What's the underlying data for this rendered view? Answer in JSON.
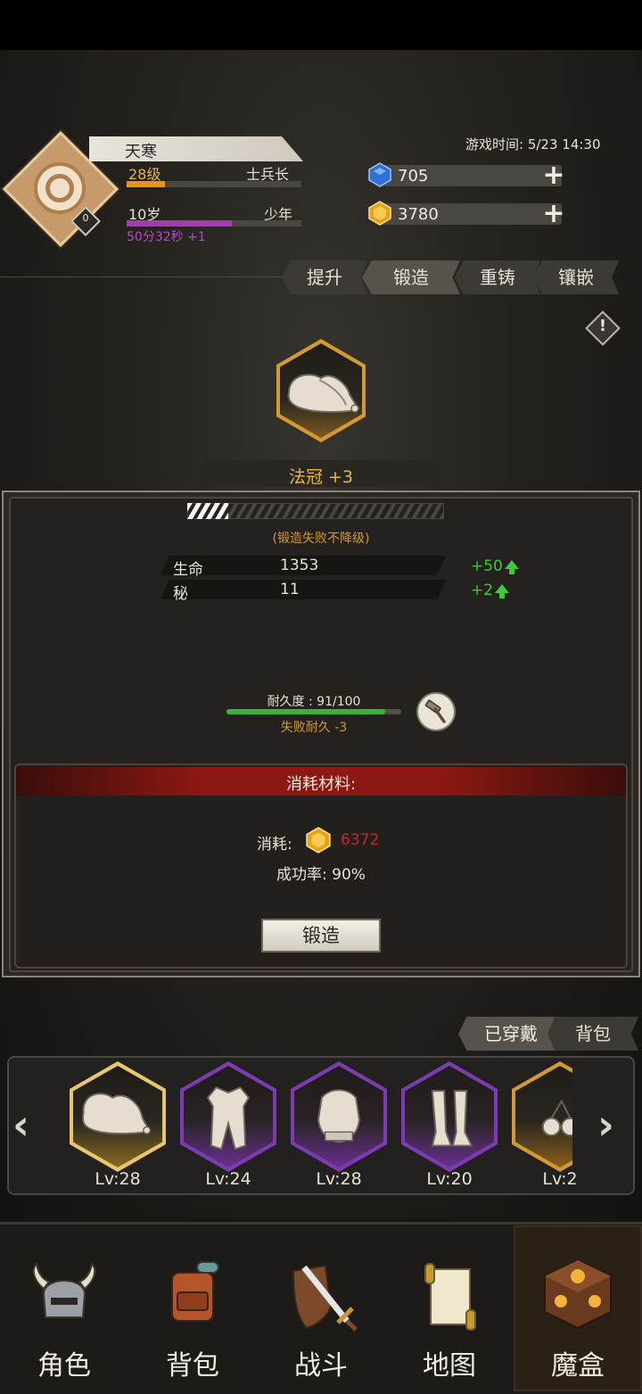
{
  "player": {
    "name": "天寒",
    "avatar_badge": "0",
    "level": "28级",
    "rank": "士兵长",
    "level_progress": 0.22,
    "age": "10岁",
    "age_stage": "少年",
    "age_progress": 0.6,
    "age_timer": "50分32秒 +1"
  },
  "game_time": "游戏时间: 5/23 14:30",
  "currency": {
    "gems": "705",
    "gold": "3780",
    "gem_icon": "blue-gem-icon",
    "gold_icon": "gold-gem-icon"
  },
  "tabs": [
    {
      "label": "提升",
      "active": false
    },
    {
      "label": "锻造",
      "active": true
    },
    {
      "label": "重铸",
      "active": false
    },
    {
      "label": "镶嵌",
      "active": false
    }
  ],
  "item": {
    "name": "法冠 +3",
    "icon": "wizard-hat-icon"
  },
  "forge": {
    "progress_fraction": 0.16,
    "note": "(锻造失败不降级)",
    "stats": [
      {
        "label": "生命",
        "value": "1353",
        "gain": "+50"
      },
      {
        "label": "秘",
        "value": "11",
        "gain": "+2"
      }
    ],
    "durability_label": "耐久度 : 91/100",
    "durability_fraction": 0.91,
    "fail_durability": "失败耐久 -3",
    "materials_title": "消耗材料:",
    "consume_label": "消耗:",
    "consume_value": "6372",
    "success_rate": "成功率: 90%",
    "button": "锻造"
  },
  "equipment": {
    "tabs": [
      {
        "label": "已穿戴",
        "active": true
      },
      {
        "label": "背包",
        "active": false
      }
    ],
    "slots": [
      {
        "icon": "wizard-hat-icon",
        "level": "Lv:28",
        "frame": "#e8c76a",
        "selected": true
      },
      {
        "icon": "robe-icon",
        "level": "Lv:24",
        "frame": "#7c3bb0",
        "selected": false
      },
      {
        "icon": "chest-armor-icon",
        "level": "Lv:28",
        "frame": "#7c3bb0",
        "selected": false
      },
      {
        "icon": "greaves-icon",
        "level": "Lv:20",
        "frame": "#7c3bb0",
        "selected": false
      },
      {
        "icon": "pendant-icon",
        "level": "Lv:2",
        "frame": "#d39b2f",
        "selected": false
      }
    ]
  },
  "nav": [
    {
      "label": "角色",
      "icon": "horned-helmet-icon",
      "active": false
    },
    {
      "label": "背包",
      "icon": "backpack-icon",
      "active": false
    },
    {
      "label": "战斗",
      "icon": "sword-shield-icon",
      "active": false
    },
    {
      "label": "地图",
      "icon": "scroll-map-icon",
      "active": false
    },
    {
      "label": "魔盒",
      "icon": "magic-box-icon",
      "active": true
    }
  ],
  "colors": {
    "accent_gold": "#e8b64a",
    "gain_green": "#3ec93a",
    "cost_red": "#c6292a",
    "epic_purple": "#7c3bb0"
  }
}
